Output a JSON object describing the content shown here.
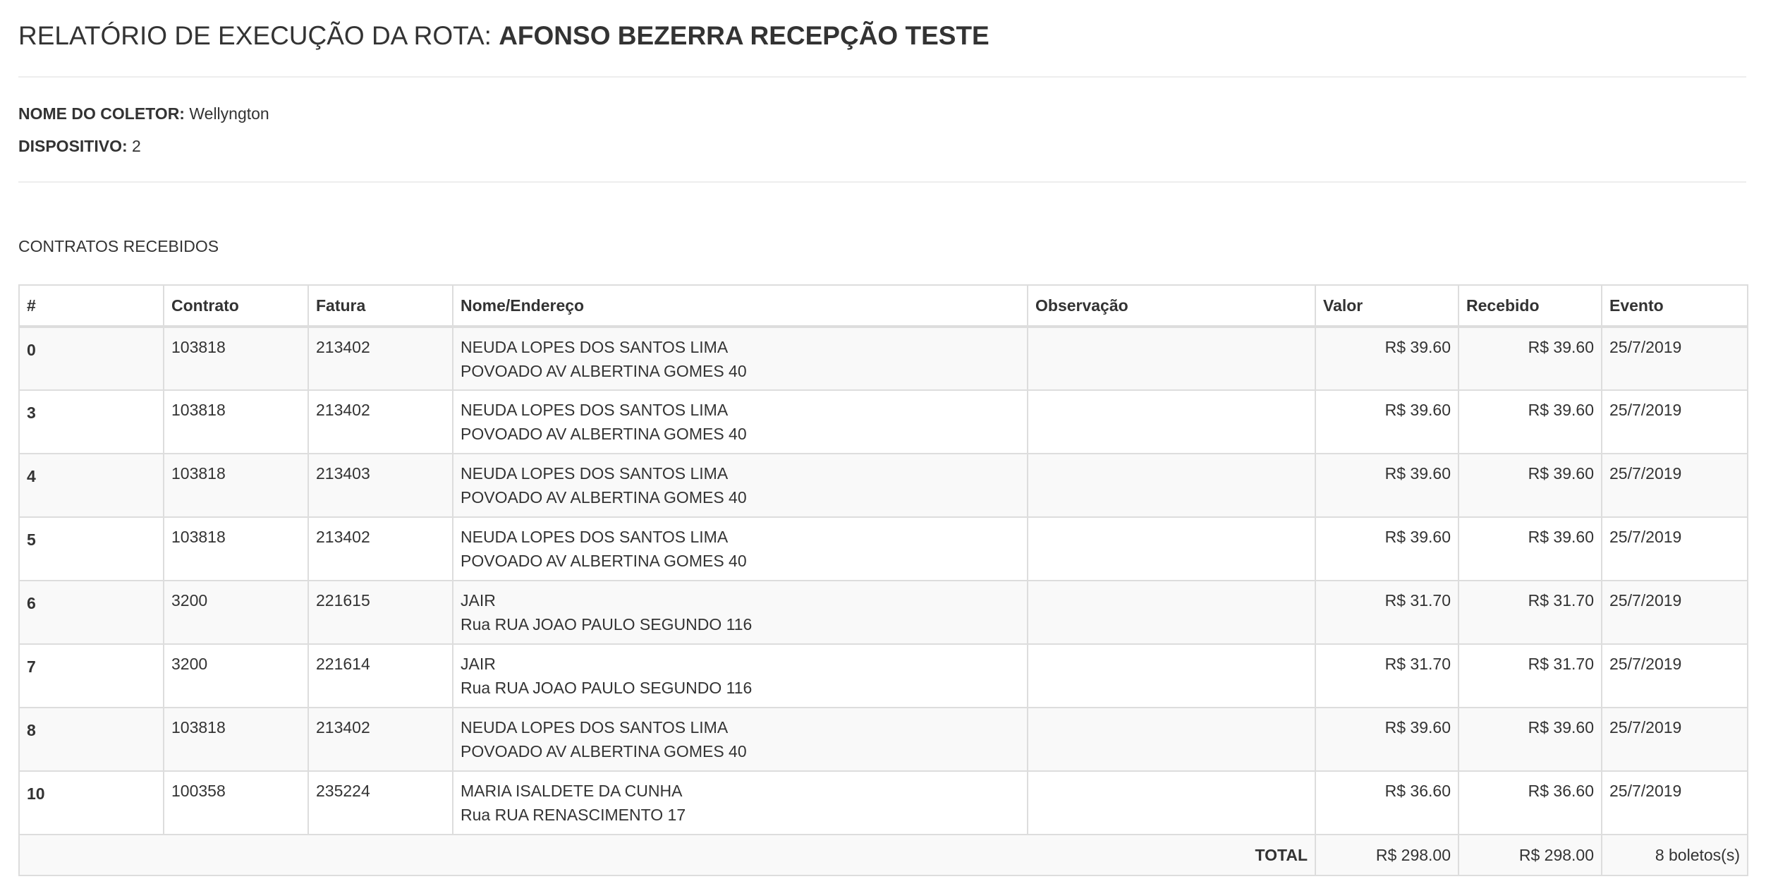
{
  "report": {
    "title_prefix": "RELATÓRIO DE EXECUÇÃO DA ROTA:",
    "route_name": "AFONSO BEZERRA RECEPÇÃO TESTE",
    "collector_label": "NOME DO COLETOR:",
    "collector_value": "Wellyngton",
    "device_label": "DISPOSITIVO:",
    "device_value": "2",
    "section_title": "CONTRATOS RECEBIDOS"
  },
  "table": {
    "headers": {
      "index": "#",
      "contract": "Contrato",
      "invoice": "Fatura",
      "name_address": "Nome/Endereço",
      "observation": "Observação",
      "value": "Valor",
      "received": "Recebido",
      "event": "Evento"
    },
    "rows": [
      {
        "index": "0",
        "contract": "103818",
        "invoice": "213402",
        "name": "NEUDA LOPES DOS SANTOS LIMA",
        "address": "POVOADO AV ALBERTINA GOMES 40",
        "observation": "",
        "value": "R$ 39.60",
        "received": "R$ 39.60",
        "event": "25/7/2019"
      },
      {
        "index": "3",
        "contract": "103818",
        "invoice": "213402",
        "name": "NEUDA LOPES DOS SANTOS LIMA",
        "address": "POVOADO AV ALBERTINA GOMES 40",
        "observation": "",
        "value": "R$ 39.60",
        "received": "R$ 39.60",
        "event": "25/7/2019"
      },
      {
        "index": "4",
        "contract": "103818",
        "invoice": "213403",
        "name": "NEUDA LOPES DOS SANTOS LIMA",
        "address": "POVOADO AV ALBERTINA GOMES 40",
        "observation": "",
        "value": "R$ 39.60",
        "received": "R$ 39.60",
        "event": "25/7/2019"
      },
      {
        "index": "5",
        "contract": "103818",
        "invoice": "213402",
        "name": "NEUDA LOPES DOS SANTOS LIMA",
        "address": "POVOADO AV ALBERTINA GOMES 40",
        "observation": "",
        "value": "R$ 39.60",
        "received": "R$ 39.60",
        "event": "25/7/2019"
      },
      {
        "index": "6",
        "contract": "3200",
        "invoice": "221615",
        "name": "JAIR",
        "address": "Rua RUA JOAO PAULO SEGUNDO 116",
        "observation": "",
        "value": "R$ 31.70",
        "received": "R$ 31.70",
        "event": "25/7/2019"
      },
      {
        "index": "7",
        "contract": "3200",
        "invoice": "221614",
        "name": "JAIR",
        "address": "Rua RUA JOAO PAULO SEGUNDO 116",
        "observation": "",
        "value": "R$ 31.70",
        "received": "R$ 31.70",
        "event": "25/7/2019"
      },
      {
        "index": "8",
        "contract": "103818",
        "invoice": "213402",
        "name": "NEUDA LOPES DOS SANTOS LIMA",
        "address": "POVOADO AV ALBERTINA GOMES 40",
        "observation": "",
        "value": "R$ 39.60",
        "received": "R$ 39.60",
        "event": "25/7/2019"
      },
      {
        "index": "10",
        "contract": "100358",
        "invoice": "235224",
        "name": "MARIA ISALDETE DA CUNHA",
        "address": "Rua RUA RENASCIMENTO 17",
        "observation": "",
        "value": "R$ 36.60",
        "received": "R$ 36.60",
        "event": "25/7/2019"
      }
    ],
    "footer": {
      "total_label": "TOTAL",
      "total_value": "R$ 298.00",
      "total_received": "R$ 298.00",
      "count": "8 boletos(s)"
    }
  }
}
